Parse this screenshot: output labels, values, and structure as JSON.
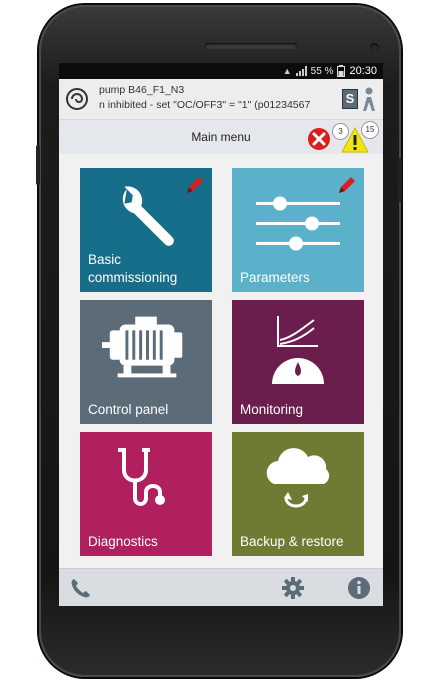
{
  "statusbar": {
    "battery": "55 %",
    "time": "20:30"
  },
  "device": {
    "name": "pump B46_F1_N3",
    "message": "n inhibited - set \"OC/OFF3\" = \"1\" (p01234567",
    "access_badge": "S"
  },
  "header": {
    "title": "Main menu",
    "error_count": "3",
    "warning_count": "15"
  },
  "tiles": [
    {
      "label_line1": "Basic",
      "label_line2": "commissioning",
      "icon": "wrench-icon",
      "color": "#176e8b",
      "editable": true
    },
    {
      "label_line1": "Parameters",
      "icon": "sliders-icon",
      "color": "#5ab1c9",
      "editable": true
    },
    {
      "label_line1": "Control panel",
      "icon": "motor-icon",
      "color": "#5b6b78"
    },
    {
      "label_line1": "Monitoring",
      "icon": "gauge-chart-icon",
      "color": "#6b1e4d"
    },
    {
      "label_line1": "Diagnostics",
      "icon": "stethoscope-icon",
      "color": "#b01f5e"
    },
    {
      "label_line1": "Backup & restore",
      "icon": "cloud-sync-icon",
      "color": "#6f7a33"
    }
  ],
  "bottombar": {
    "icons": [
      "phone-icon",
      "settings-gear-icon",
      "info-icon"
    ]
  },
  "colors": {
    "error": "#d9201f",
    "warning": "#f3e417",
    "edit_pencil": "#d9201f"
  }
}
